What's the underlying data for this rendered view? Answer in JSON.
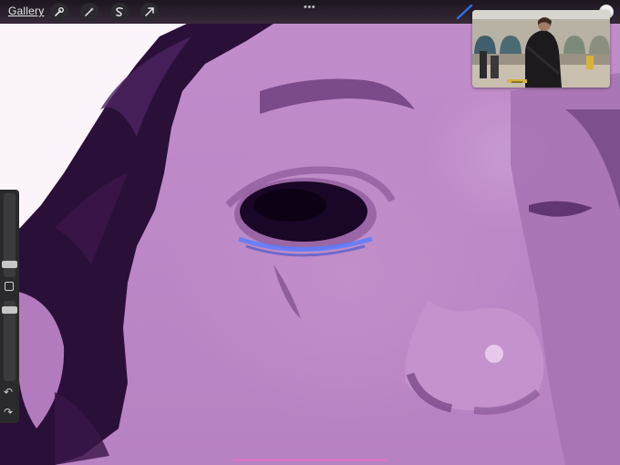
{
  "toolbar": {
    "gallery_label": "Gallery",
    "actions_icon": "wrench-icon",
    "adjustments_icon": "magic-wand-icon",
    "selection_icon": "selection-s-icon",
    "transform_icon": "arrow-cursor-icon",
    "more_dots": "•••",
    "brush_icon": "brush-icon",
    "current_color": "#f2f2f2",
    "brush_color": "#2f6fe0"
  },
  "reference": {
    "banner_text": "▬▬▬▬"
  },
  "sidebar": {
    "size_slider_level": 0.3,
    "opacity_slider_level": 0.68,
    "modify_icon": "square-icon",
    "undo_label": "↶",
    "redo_label": "↷"
  },
  "colors": {
    "skin": "#c18dcb",
    "hair": "#2a0f38",
    "highlight": "#5a7dff",
    "home_indicator": "#d778c4"
  }
}
